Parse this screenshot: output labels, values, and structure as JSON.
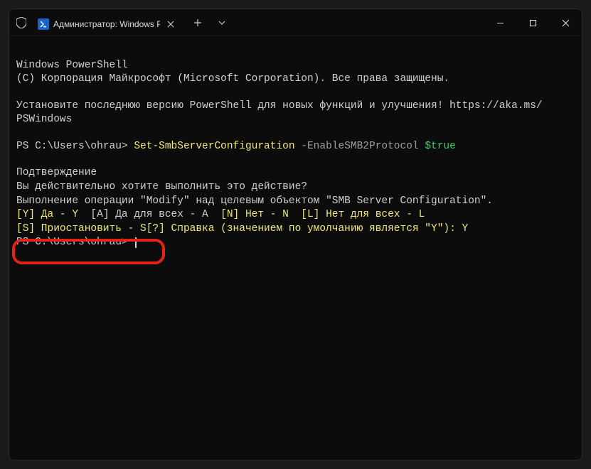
{
  "titlebar": {
    "tab_title": "Администратор: Windows Pc"
  },
  "terminal": {
    "line1": "Windows PowerShell",
    "line2": "(C) Корпорация Майкрософт (Microsoft Corporation). Все права защищены.",
    "line3a": "Установите последнюю версию PowerShell для новых функций и улучшения! https://aka.ms/",
    "line3b": "PSWindows",
    "prompt1": "PS C:\\Users\\ohrau> ",
    "cmd": "Set-SmbServerConfiguration",
    "param": " -EnableSMB2Protocol ",
    "arg": "$true",
    "confirm_hdr": "Подтверждение",
    "confirm_q": "Вы действительно хотите выполнить это действие?",
    "confirm_op": "Выполнение операции \"Modify\" над целевым объектом \"SMB Server Configuration\".",
    "opt_y": "[Y] Да - Y",
    "opt_a": "  [A] Да для всех - A  ",
    "opt_n": "[N] Нет - N  ",
    "opt_l": "[L] Нет для всех - L",
    "opt_s": "[S] Приостановить - S",
    "opt_help": "[?] Справка (значением по умолчанию является \"Y\"): Y",
    "prompt2": "PS C:\\Users\\ohrau> "
  }
}
